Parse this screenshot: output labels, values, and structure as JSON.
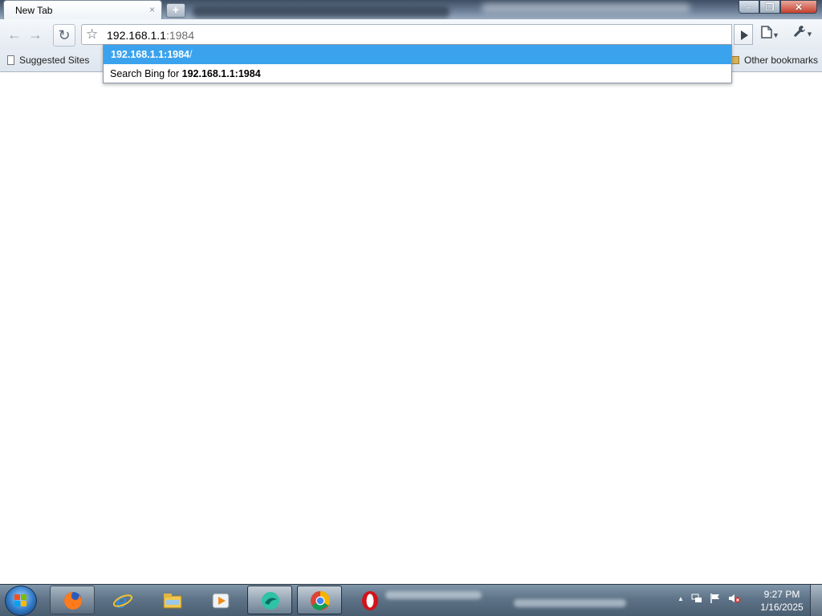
{
  "browser": {
    "tab": {
      "title": "New Tab",
      "close_glyph": "×"
    },
    "new_tab_glyph": "+",
    "window_controls": {
      "minimize": "–",
      "maximize": "❐",
      "close": "✕"
    },
    "toolbar": {
      "back_icon": "←",
      "forward_icon": "→",
      "reload_icon": "↻",
      "star_icon": "☆",
      "address": {
        "typed": "192.168.1.1",
        "completion": ":1984"
      },
      "go_icon": "play-arrow-icon",
      "page_menu_icon": "page-icon",
      "wrench_icon": "wrench-icon"
    },
    "bookmarks": {
      "suggested": "Suggested Sites",
      "other": "Other bookmarks"
    },
    "autocomplete": {
      "selected": {
        "host": "192.168.1.1:1984",
        "slash": "/"
      },
      "search": {
        "prefix": "Search Bing for ",
        "query": "192.168.1.1:1984"
      }
    }
  },
  "taskbar": {
    "apps": [
      "firefox-icon",
      "internet-explorer-icon",
      "file-explorer-icon",
      "media-player-icon",
      "app-icon",
      "chrome-icon",
      "opera-icon"
    ],
    "tray": {
      "show_hidden": "▲"
    },
    "clock": {
      "time": "9:27 PM",
      "date": "1/16/2025"
    }
  },
  "colors": {
    "selection": "#3ba3ee",
    "accent": "#2f78c4"
  }
}
